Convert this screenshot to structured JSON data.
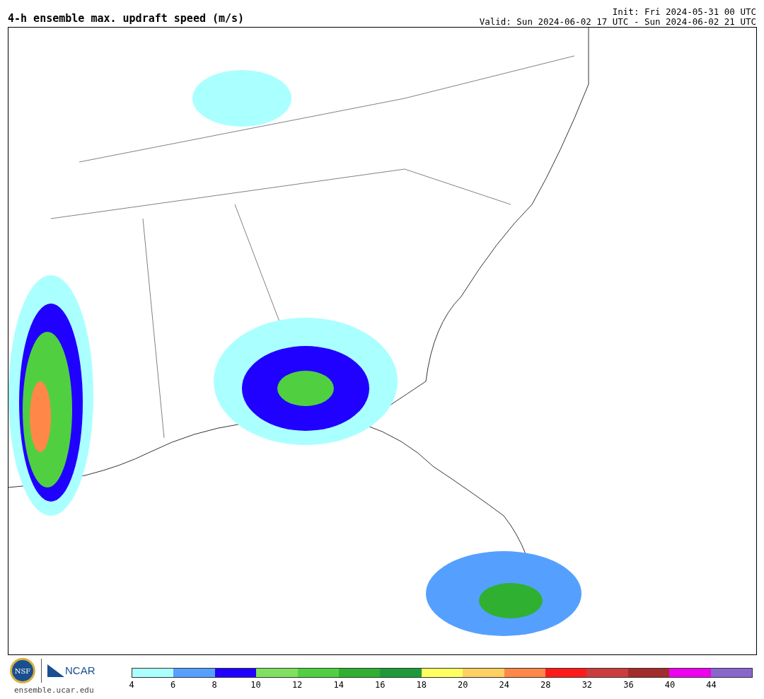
{
  "title": "4-h ensemble max. updraft speed (m/s)",
  "init": "Init: Fri 2024-05-31 00 UTC",
  "valid": "Valid: Sun 2024-06-02 17 UTC - Sun 2024-06-02 21 UTC",
  "logos": {
    "nsf": "NSF",
    "ncar": "NCAR",
    "url": "ensemble.ucar.edu"
  },
  "colorbar": {
    "segments": [
      {
        "color": "#aaffff"
      },
      {
        "color": "#55a0ff"
      },
      {
        "color": "#2000ff"
      },
      {
        "color": "#80e060"
      },
      {
        "color": "#50d040"
      },
      {
        "color": "#30b030"
      },
      {
        "color": "#1f9a3a"
      },
      {
        "color": "#ffff60"
      },
      {
        "color": "#ffd060"
      },
      {
        "color": "#ff8848"
      },
      {
        "color": "#ff1a1a"
      },
      {
        "color": "#cc3c3c"
      },
      {
        "color": "#a32b2b"
      },
      {
        "color": "#ee00ee"
      },
      {
        "color": "#8866cc"
      }
    ],
    "ticks": [
      "4",
      "6",
      "8",
      "10",
      "12",
      "14",
      "16",
      "18",
      "20",
      "24",
      "28",
      "32",
      "36",
      "40",
      "44"
    ]
  }
}
